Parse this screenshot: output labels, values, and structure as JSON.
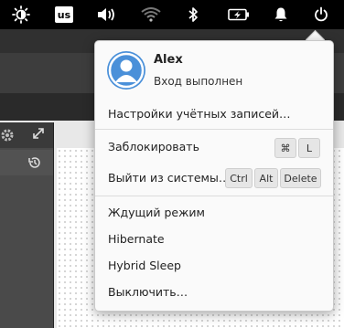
{
  "panel": {
    "keyboard_layout": "us",
    "icons": [
      "brightness-icon",
      "keyboard-layout-badge",
      "volume-icon",
      "wifi-icon",
      "bluetooth-icon",
      "battery-icon",
      "notifications-icon",
      "power-icon"
    ]
  },
  "user_menu": {
    "user_name": "Alex",
    "user_status": "Вход выполнен",
    "items": {
      "accounts": "Настройки учётных записей…",
      "lock": "Заблокировать",
      "logout": "Выйти из системы…",
      "suspend": "Ждущий режим",
      "hibernate": "Hibernate",
      "hybrid_sleep": "Hybrid Sleep",
      "shutdown": "Выключить…"
    },
    "shortcuts": {
      "lock": [
        "⌘",
        "L"
      ],
      "logout": [
        "Ctrl",
        "Alt",
        "Delete"
      ]
    }
  },
  "colors": {
    "panel_bg": "#000000",
    "avatar": "#4a90d9",
    "popover_bg": "#fafafa"
  }
}
